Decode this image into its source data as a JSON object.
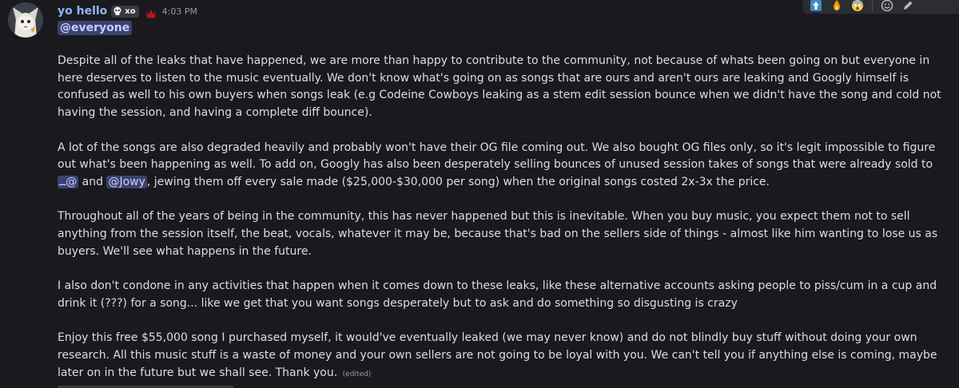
{
  "message": {
    "author": "yo hello",
    "tag": "xo",
    "timestamp": "4:03 PM",
    "mention": "@everyone",
    "paragraphs": {
      "p1": "Despite all of the leaks that have happened, we are more than happy to contribute to the community, not because of whats been going on but everyone in here deserves to listen to the music eventually. We don't know what's going on as songs that are ours and aren't ours are leaking and Googly himself is confused as well to his own buyers when songs leak (e.g Codeine Cowboys leaking as a stem edit session bounce when we didn't have the song and cold not having the session, and having a complete diff bounce).",
      "p2_before": "A lot of the songs are also degraded heavily and probably won't have their OG file coming out. We also bought OG files only, so it's legit impossible to figure out what's been happening as well. To add on, Googly has also been desperately selling bounces of unused session takes of songs that were already sold to ",
      "p2_mention1": "ــ@",
      "p2_and": " and ",
      "p2_mention2": "@Jowy",
      "p2_after": ", jewing them off every sale made ($25,000-$30,000 per song) when the original songs costed 2x-3x the price.",
      "p3": "Throughout all of the years of being in the community, this has never happened but this is inevitable. When you buy music, you expect them not to sell anything from the session itself, the beat, vocals, whatever it may be, because that's bad on the sellers side of things - almost like him wanting to lose us as buyers. We'll see what happens in the future.",
      "p4": "I also don't condone in any activities that happen when it comes down to these leaks, like these alternative accounts asking people to piss/cum in a cup and drink it (???) for a song... like we get that you want songs desperately but to ask and do something so disgusting is crazy",
      "p5": "Enjoy this free $55,000 song I purchased myself, it would've eventually leaked (we may never know) and do not blindly buy stuff without doing your own research. All this music stuff is a waste of money and your own sellers are not going to be loyal with you. We can't tell you if anything else is coming, maybe later on in the future but we shall see. Thank you.",
      "edited": "(edited)"
    }
  },
  "colors": {
    "background": "#1a1a1e",
    "username": "#8fb4ff",
    "mention_bg": "#3c4270",
    "mention_fg": "#c9cdfb",
    "timestamp": "#949ba4",
    "text": "#dbdee1"
  },
  "toolbar": {
    "reactions": [
      "upload-arrow-icon",
      "fire-reaction-icon",
      "scream-reaction-icon"
    ],
    "actions": [
      "add-reaction-icon",
      "edit-icon"
    ]
  }
}
